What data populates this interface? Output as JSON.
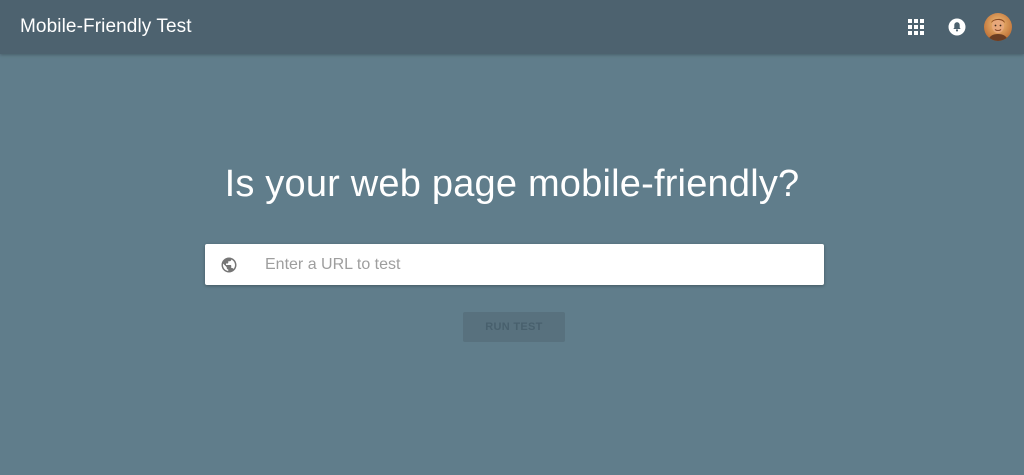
{
  "app": {
    "title": "Mobile-Friendly Test"
  },
  "header": {
    "icons": [
      "apps-grid-icon",
      "notifications-bell-icon",
      "account-avatar"
    ]
  },
  "main": {
    "headline": "Is your web page mobile-friendly?",
    "url_input": {
      "placeholder": "Enter a URL to test",
      "value": "",
      "icon": "globe-icon"
    },
    "run_button_label": "RUN TEST"
  },
  "colors": {
    "background": "#607d8b",
    "topbar": "#4d626f",
    "text_on_dark": "#ffffff",
    "button_disabled_bg": "#58717e"
  }
}
